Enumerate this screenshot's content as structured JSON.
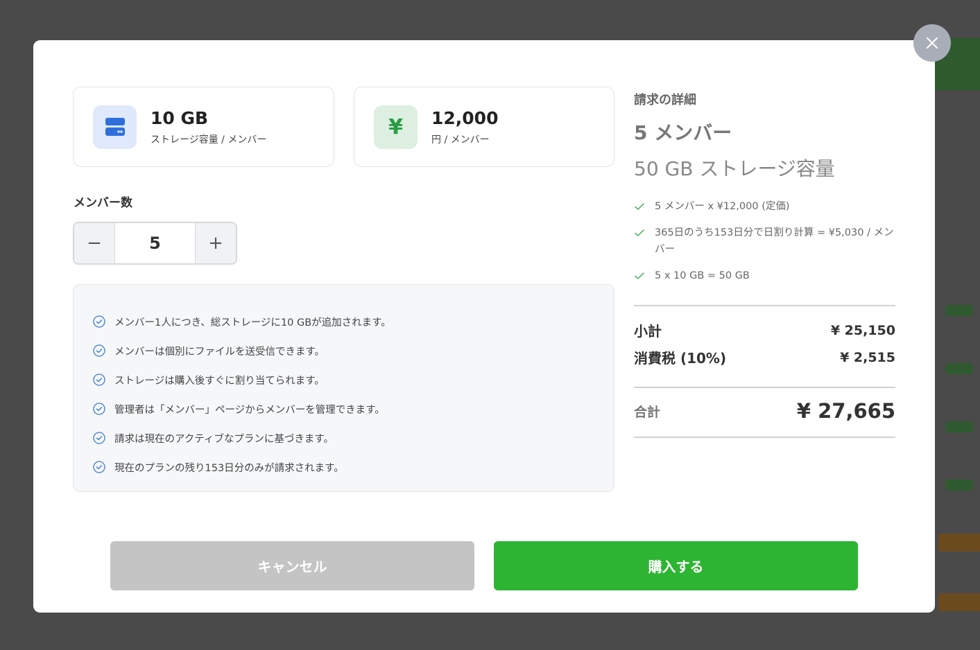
{
  "storage_card": {
    "value": "10 GB",
    "label": "ストレージ容量 / メンバー"
  },
  "price_card": {
    "icon_glyph": "¥",
    "value": "12,000",
    "label": "円 / メンバー"
  },
  "member_count": {
    "label": "メンバー数",
    "value": "5",
    "minus": "−",
    "plus": "+"
  },
  "info_items": [
    "メンバー1人につき、総ストレージに10 GBが追加されます。",
    "メンバーは個別にファイルを送受信できます。",
    "ストレージは購入後すぐに割り当てられます。",
    "管理者は「メンバー」ページからメンバーを管理できます。",
    "請求は現在のアクティブなプランに基づきます。",
    "現在のプランの残り153日分のみが請求されます。"
  ],
  "billing": {
    "title": "請求の詳細",
    "members": "5 メンバー",
    "storage": "50 GB ストレージ容量",
    "calc": [
      "5 メンバー x ¥12,000 (定価)",
      "365日のうち153日分で日割り計算 = ¥5,030 / メンバー",
      "5 x 10 GB = 50 GB"
    ],
    "subtotal_label": "小計",
    "subtotal_value": "¥ 25,150",
    "tax_label": "消費税 (10%)",
    "tax_value": "¥ 2,515",
    "total_label": "合計",
    "total_value": "¥ 27,665"
  },
  "buttons": {
    "cancel": "キャンセル",
    "buy": "購入する"
  },
  "colors": {
    "accent_green": "#2db432",
    "check_blue": "#3a7bd5",
    "check_green": "#3aa655"
  }
}
